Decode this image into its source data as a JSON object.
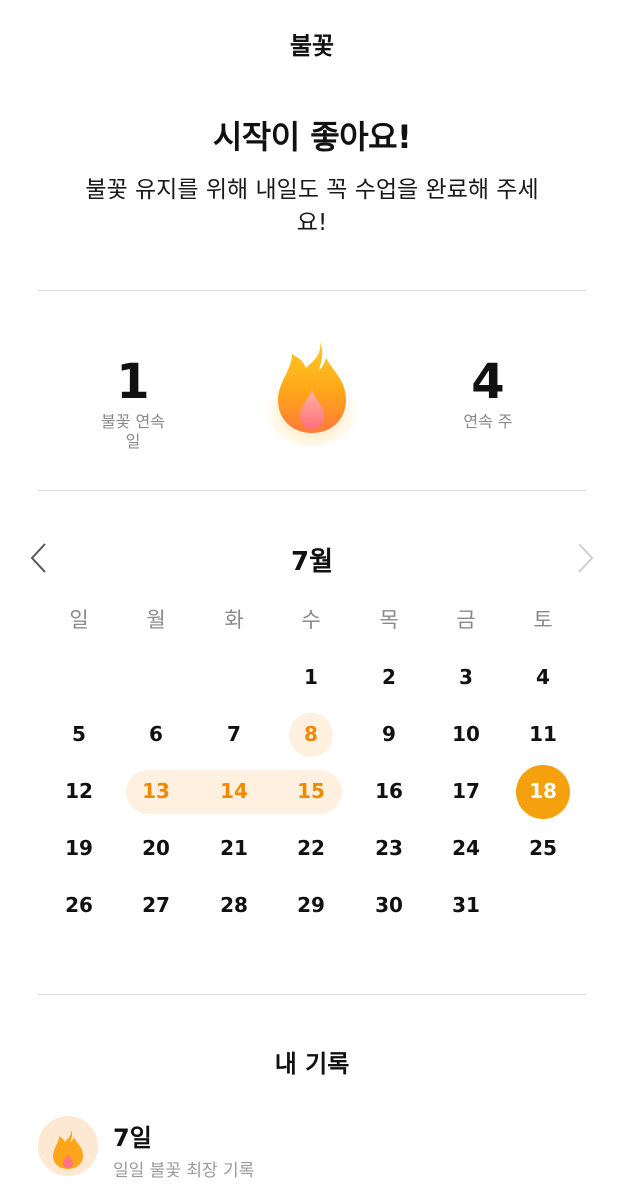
{
  "header": {
    "title": "불꽃"
  },
  "hero": {
    "headline": "시작이 좋아요!",
    "message": "불꽃 유지를 위해 내일도 꼭 수업을 완료해 주세요!"
  },
  "stats": {
    "days": {
      "value": "1",
      "label": "불꽃 연속일"
    },
    "weeks": {
      "value": "4",
      "label": "연속 주"
    },
    "icon": "flame-icon"
  },
  "calendar": {
    "month_label": "7월",
    "prev_icon": "chevron-left-icon",
    "next_icon": "chevron-right-icon",
    "weekdays": [
      "일",
      "월",
      "화",
      "수",
      "목",
      "금",
      "토"
    ],
    "first_weekday_index": 3,
    "days_in_month": 31,
    "single_streak_days": [
      8
    ],
    "streak_range": [
      13,
      15
    ],
    "today": 18,
    "colors": {
      "accent": "#f5a00d",
      "streak_text": "#f08a00",
      "streak_bg": "#fff0e0"
    }
  },
  "records": {
    "title": "내 기록",
    "items": [
      {
        "value": "7일",
        "label": "일일 불꽃 최장 기록",
        "icon": "flame-icon"
      }
    ]
  }
}
